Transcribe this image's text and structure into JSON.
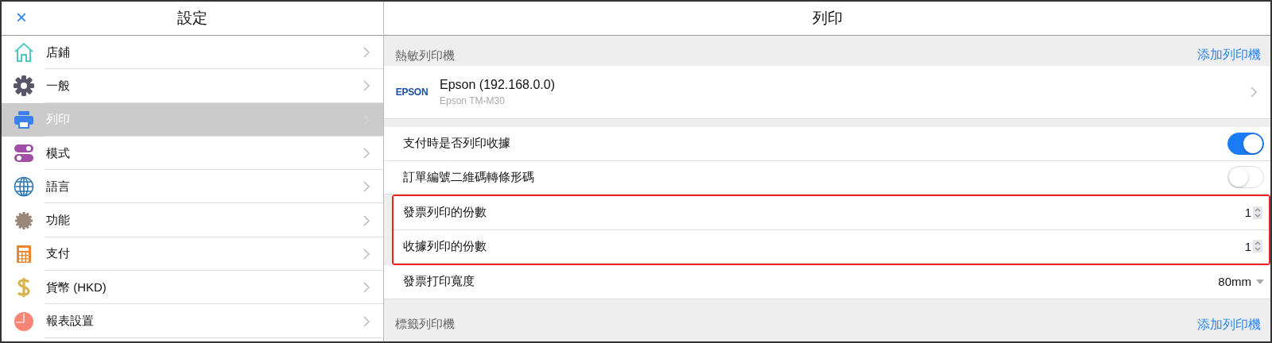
{
  "sidebar": {
    "close": "×",
    "title": "設定",
    "items": [
      {
        "label": "店鋪",
        "selected": false
      },
      {
        "label": "一般",
        "selected": false
      },
      {
        "label": "列印",
        "selected": true
      },
      {
        "label": "模式",
        "selected": false
      },
      {
        "label": "語言",
        "selected": false
      },
      {
        "label": "功能",
        "selected": false
      },
      {
        "label": "支付",
        "selected": false
      },
      {
        "label": "貨幣 (HKD)",
        "selected": false
      },
      {
        "label": "報表設置",
        "selected": false
      }
    ]
  },
  "main": {
    "title": "列印",
    "thermal_section": {
      "heading": "熱敏列印機",
      "action": "添加列印機"
    },
    "printer": {
      "logo": "EPSON",
      "name": "Epson (192.168.0.0)",
      "model": "Epson TM-M30"
    },
    "settings": [
      {
        "kind": "toggle",
        "label": "支付時是否列印收據",
        "on": true,
        "highlighted": false
      },
      {
        "kind": "toggle",
        "label": "訂單編號二維碼轉條形碼",
        "on": false,
        "highlighted": false
      },
      {
        "kind": "stepper",
        "label": "發票列印的份數",
        "value": "1",
        "highlighted": true
      },
      {
        "kind": "stepper",
        "label": "收據列印的份數",
        "value": "1",
        "highlighted": true
      },
      {
        "kind": "select",
        "label": "發票打印寬度",
        "value": "80mm",
        "highlighted": false
      }
    ],
    "label_section": {
      "heading": "標籤列印機",
      "action": "添加列印機"
    }
  }
}
